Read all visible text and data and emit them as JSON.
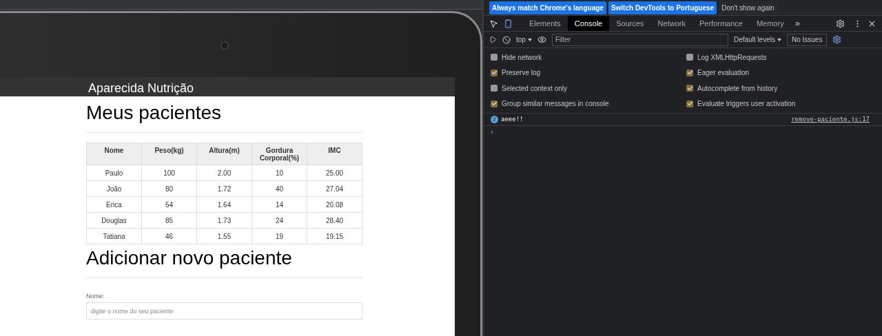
{
  "page": {
    "header": "Aparecida Nutrição",
    "title": "Meus pacientes",
    "table": {
      "columns": [
        "Nome",
        "Peso(kg)",
        "Altura(m)",
        "Gordura Corporal(%)",
        "IMC"
      ],
      "rows": [
        [
          "Paulo",
          "100",
          "2.00",
          "10",
          "25.00"
        ],
        [
          "João",
          "80",
          "1.72",
          "40",
          "27.04"
        ],
        [
          "Erica",
          "54",
          "1.64",
          "14",
          "20.08"
        ],
        [
          "Douglas",
          "85",
          "1.73",
          "24",
          "28.40"
        ],
        [
          "Tatiana",
          "46",
          "1.55",
          "19",
          "19.15"
        ]
      ]
    },
    "form_title": "Adicionar novo paciente",
    "name_label": "Nome:",
    "name_field": {
      "placeholder": "digite o nome do seu paciente"
    }
  },
  "devtools": {
    "infobar": [
      {
        "label": "Always match Chrome's language",
        "kind": "primary"
      },
      {
        "label": "Switch DevTools to Portuguese",
        "kind": "primary"
      },
      {
        "label": "Don't show again",
        "kind": "plain"
      }
    ],
    "tabs": [
      {
        "label": "Elements",
        "selected": false
      },
      {
        "label": "Console",
        "selected": true
      },
      {
        "label": "Sources",
        "selected": false
      },
      {
        "label": "Network",
        "selected": false
      },
      {
        "label": "Performance",
        "selected": false
      },
      {
        "label": "Memory",
        "selected": false
      }
    ],
    "more_tabs": "»",
    "context": "top",
    "filter": {
      "placeholder": "Filter"
    },
    "levels": "Default levels",
    "issues": "No Issues",
    "settings": [
      {
        "label": "Hide network",
        "checked": false
      },
      {
        "label": "Log XMLHttpRequests",
        "checked": false
      },
      {
        "label": "Preserve log",
        "checked": true
      },
      {
        "label": "Eager evaluation",
        "checked": true
      },
      {
        "label": "Selected context only",
        "checked": false
      },
      {
        "label": "Autocomplete from history",
        "checked": true
      },
      {
        "label": "Group similar messages in console",
        "checked": true
      },
      {
        "label": "Evaluate triggers user activation",
        "checked": true
      }
    ],
    "messages": [
      {
        "count": "2",
        "text": "aeee!!",
        "source": "remove-paciente.js:17"
      }
    ],
    "prompt": "›"
  }
}
